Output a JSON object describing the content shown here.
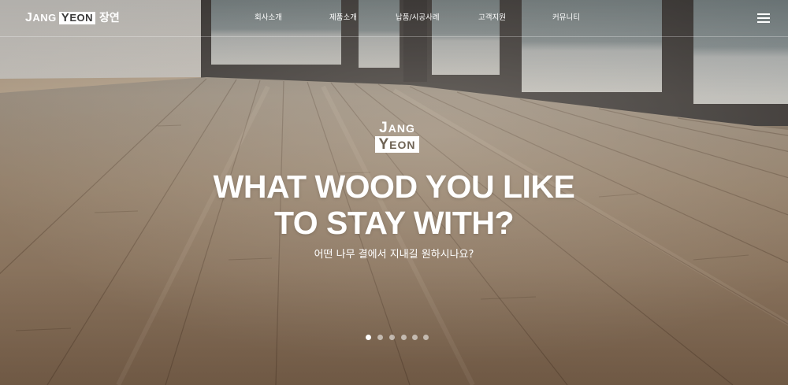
{
  "brand": {
    "logo_j": "J",
    "logo_ang": "ANG",
    "logo_y": "Y",
    "logo_eon": "EON",
    "name_ko": "장연"
  },
  "nav": {
    "items": [
      {
        "label": "회사소개"
      },
      {
        "label": "제품소개"
      },
      {
        "label": "납품/시공사례"
      },
      {
        "label": "고객지원"
      },
      {
        "label": "커뮤니티"
      }
    ],
    "menu_icon": "hamburger-menu-icon"
  },
  "hero": {
    "headline_line1": "WHAT WOOD YOU LIKE",
    "headline_line2": "TO STAY WITH?",
    "subheadline": "어떤 나무 결에서 지내길 원하시나요?",
    "slide_count": 6,
    "active_slide": 1
  },
  "colors": {
    "text": "#ffffff",
    "floor": "#9c8670",
    "window_frame": "#4a4644"
  }
}
